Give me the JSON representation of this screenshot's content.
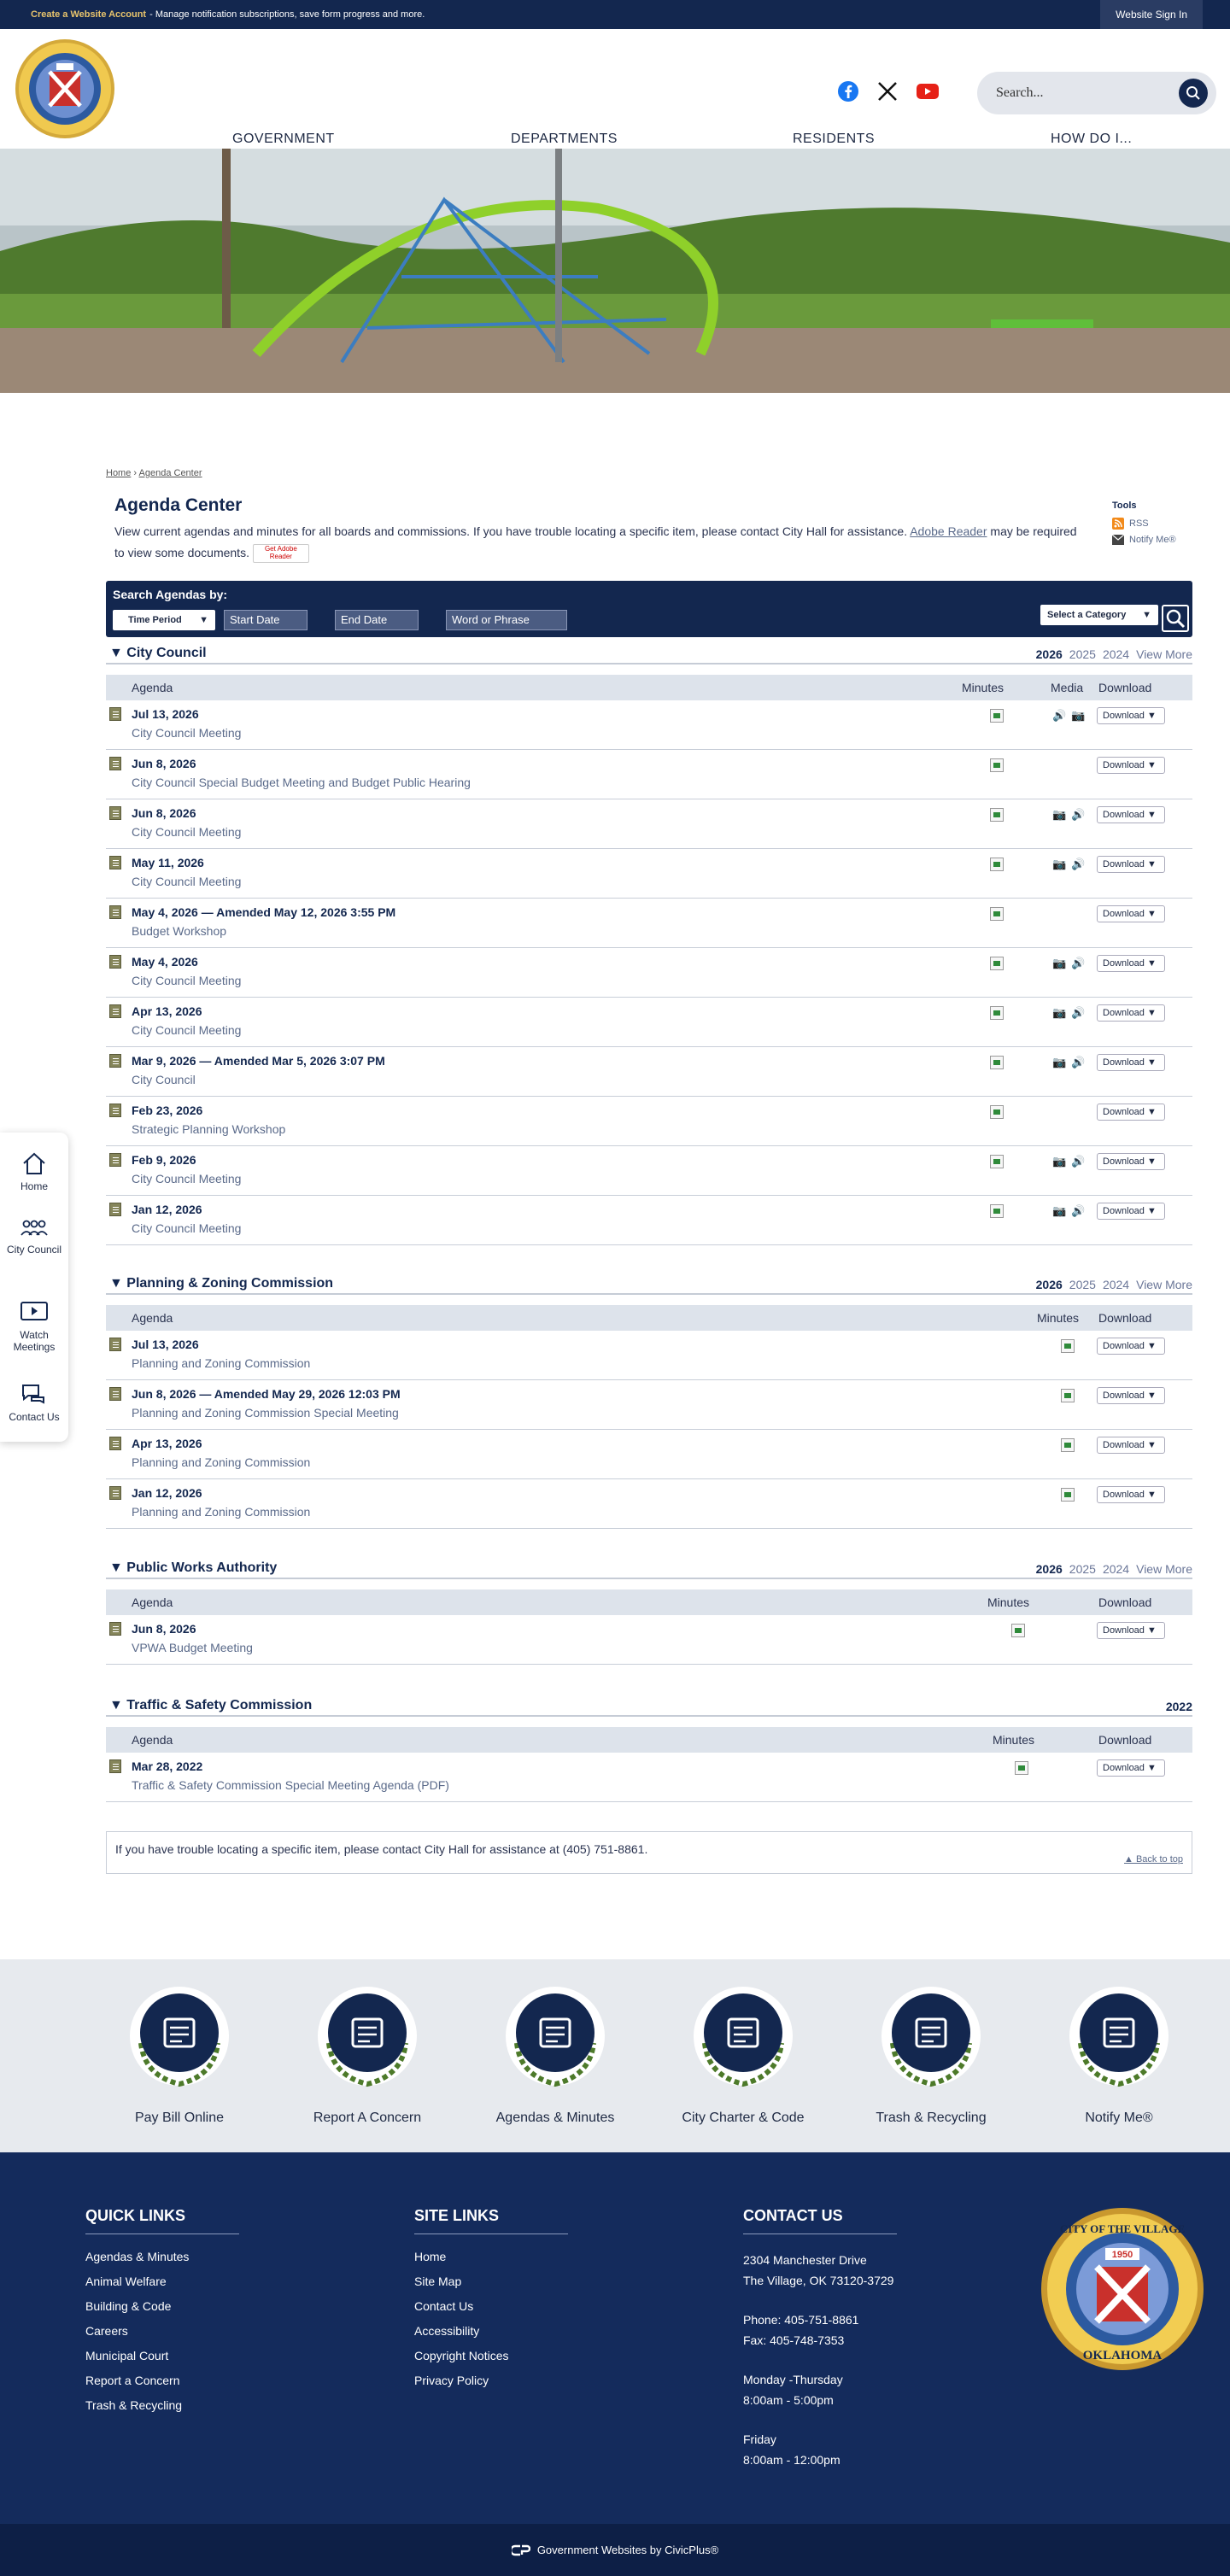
{
  "topbar": {
    "account_link": "Create a Website Account",
    "account_msg": " - Manage notification subscriptions, save form progress and more.",
    "signin": "Website Sign In"
  },
  "header": {
    "search_placeholder": "Search...",
    "nav": [
      "GOVERNMENT",
      "DEPARTMENTS",
      "RESIDENTS",
      "HOW DO I..."
    ]
  },
  "sidetools": [
    {
      "label": "Home",
      "icon": "home-icon"
    },
    {
      "label": "City Council",
      "icon": "people-icon"
    },
    {
      "label": "Watch Meetings",
      "icon": "video-icon"
    },
    {
      "label": "Contact Us",
      "icon": "chat-icon"
    }
  ],
  "breadcrumb": {
    "home": "Home",
    "sep": " › ",
    "current": "Agenda Center"
  },
  "page": {
    "title": "Agenda Center",
    "intro_1": "View current agendas and minutes for all boards and commissions. If you have trouble locating a specific item, please contact City Hall for assistance. ",
    "intro_link": "Adobe Reader",
    "intro_2": " may be required to view some documents.",
    "reader_badge": "Get Adobe Reader"
  },
  "tools": {
    "heading": "Tools",
    "rss": "RSS",
    "notify": "Notify Me®"
  },
  "search": {
    "label": "Search Agendas by:",
    "period": "Time Period",
    "start": "Start Date",
    "end": "End Date",
    "phrase": "Word or Phrase",
    "category": "Select a Category"
  },
  "columns": {
    "agenda": "Agenda",
    "minutes": "Minutes",
    "media": "Media",
    "download": "Download"
  },
  "download_label": "Download ▼",
  "sections": [
    {
      "name": "City Council",
      "years": [
        "2026",
        "2025",
        "2024"
      ],
      "view_more": "View More",
      "has_media": true,
      "rows": [
        {
          "date": "Jul 13, 2026",
          "desc": "City Council Meeting",
          "media": "audio-video"
        },
        {
          "date": "Jun 8, 2026",
          "desc": "City Council Special Budget Meeting and Budget Public Hearing",
          "media": ""
        },
        {
          "date": "Jun 8, 2026",
          "desc": "City Council Meeting",
          "media": "video-audio"
        },
        {
          "date": "May 11, 2026",
          "desc": "City Council Meeting",
          "media": "video-audio"
        },
        {
          "date": "May 4, 2026 — Amended May 12, 2026 3:55 PM",
          "desc": "Budget Workshop",
          "media": ""
        },
        {
          "date": "May 4, 2026",
          "desc": "City Council Meeting",
          "media": "video-audio"
        },
        {
          "date": "Apr 13, 2026",
          "desc": "City Council Meeting",
          "media": "video-audio"
        },
        {
          "date": "Mar 9, 2026 — Amended Mar 5, 2026 3:07 PM",
          "desc": "City Council",
          "media": "video-audio"
        },
        {
          "date": "Feb 23, 2026",
          "desc": "Strategic Planning Workshop",
          "media": ""
        },
        {
          "date": "Feb 9, 2026",
          "desc": "City Council Meeting",
          "media": "video-audio"
        },
        {
          "date": "Jan 12, 2026",
          "desc": "City Council Meeting",
          "media": "video-audio"
        }
      ]
    },
    {
      "name": "Planning & Zoning Commission",
      "years": [
        "2026",
        "2025",
        "2024"
      ],
      "view_more": "View More",
      "has_media": false,
      "rows": [
        {
          "date": "Jul 13, 2026",
          "desc": "Planning and Zoning Commission"
        },
        {
          "date": "Jun 8, 2026 — Amended May 29, 2026 12:03 PM",
          "desc": "Planning and Zoning Commission Special Meeting"
        },
        {
          "date": "Apr 13, 2026",
          "desc": "Planning and Zoning Commission"
        },
        {
          "date": "Jan 12, 2026",
          "desc": "Planning and Zoning Commission"
        }
      ]
    },
    {
      "name": "Public Works Authority",
      "years": [
        "2026",
        "2025",
        "2024"
      ],
      "view_more": "View More",
      "has_media": false,
      "rows": [
        {
          "date": "Jun 8, 2026",
          "desc": "VPWA Budget Meeting"
        }
      ]
    },
    {
      "name": "Traffic & Safety Commission",
      "years": [
        "2022"
      ],
      "view_more": "",
      "has_media": false,
      "rows": [
        {
          "date": "Mar 28, 2022",
          "desc": "Traffic & Safety Commission Special Meeting Agenda (PDF)"
        }
      ]
    }
  ],
  "note": {
    "text": "If you have trouble locating a specific item, please contact City Hall for assistance at (405) 751-8861.",
    "back": "▲ Back to top"
  },
  "quicklinks": [
    "Pay Bill Online",
    "Report A Concern",
    "Agendas & Minutes",
    "City Charter & Code",
    "Trash & Recycling",
    "Notify Me®"
  ],
  "footer": {
    "quick_title": "QUICK LINKS",
    "quick": [
      "Agendas & Minutes",
      "Animal Welfare",
      "Building & Code",
      "Careers",
      "Municipal Court",
      "Report a Concern",
      "Trash & Recycling"
    ],
    "site_title": "SITE LINKS",
    "site": [
      "Home",
      "Site Map",
      "Contact Us",
      "Accessibility",
      "Copyright Notices",
      "Privacy Policy"
    ],
    "contact_title": "CONTACT US",
    "address1": "2304 Manchester Drive",
    "address2": "The Village, OK 73120-3729",
    "phone": "Phone: 405-751-8861",
    "fax": "Fax: 405-748-7353",
    "days1": "Monday -Thursday",
    "hours1": "8:00am - 5:00pm",
    "days2": "Friday",
    "hours2": "8:00am - 12:00pm"
  },
  "seal": {
    "top": "CITY OF THE VILLAGE",
    "year": "1950",
    "bottom": "OKLAHOMA"
  },
  "bottom": {
    "text": "Government Websites by CivicPlus®"
  },
  "colors": {
    "navy": "#13274f",
    "gold": "#c9a24a",
    "footer": "#142b5c"
  }
}
